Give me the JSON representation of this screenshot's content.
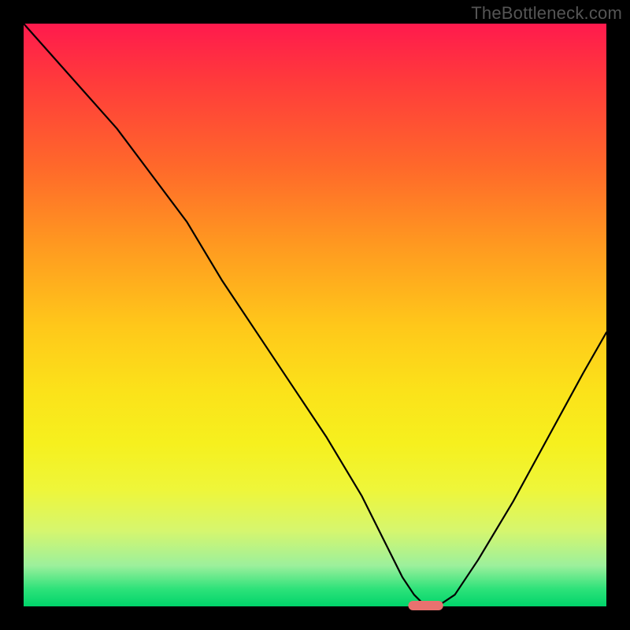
{
  "watermark": "TheBottleneck.com",
  "colors": {
    "page_bg": "#000000",
    "curve": "#000000",
    "marker": "#e9716f",
    "gradient_top": "#ff1a4d",
    "gradient_bottom": "#00d46a"
  },
  "chart_data": {
    "type": "line",
    "title": "",
    "xlabel": "",
    "ylabel": "",
    "xlim": [
      0,
      100
    ],
    "ylim": [
      0,
      100
    ],
    "grid": false,
    "legend": false,
    "annotations": [
      "TheBottleneck.com"
    ],
    "series": [
      {
        "name": "bottleneck-curve",
        "x": [
          0,
          8,
          16,
          22,
          28,
          34,
          40,
          46,
          52,
          58,
          62,
          65,
          67,
          69,
          71,
          74,
          78,
          84,
          90,
          96,
          100
        ],
        "y": [
          100,
          91,
          82,
          74,
          66,
          56,
          47,
          38,
          29,
          19,
          11,
          5,
          2,
          0,
          0,
          2,
          8,
          18,
          29,
          40,
          47
        ]
      }
    ],
    "marker": {
      "name": "optimal-point",
      "x_center": 69,
      "y": 0,
      "width_pct": 6,
      "shape": "capsule",
      "color": "#e9716f"
    }
  }
}
